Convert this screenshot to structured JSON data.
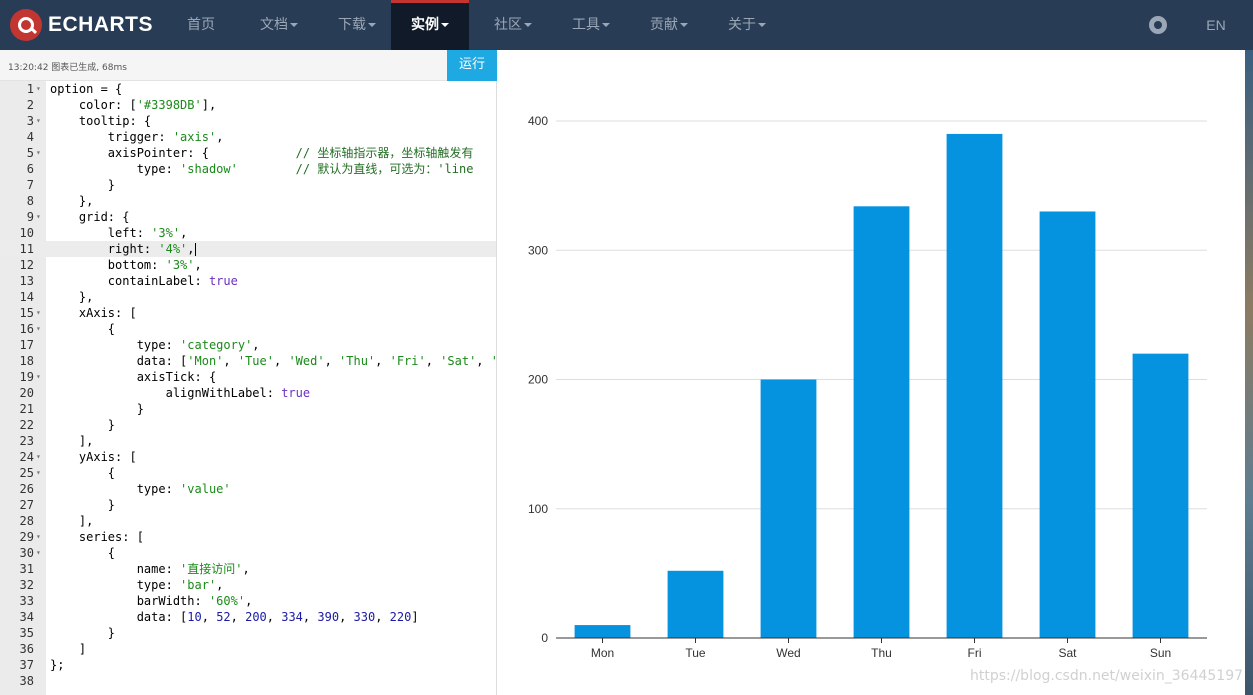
{
  "nav": {
    "logo_text": "ECHARTS",
    "items": [
      {
        "label": "首页",
        "caret": false,
        "active": false
      },
      {
        "label": "文档",
        "caret": true,
        "active": false
      },
      {
        "label": "下载",
        "caret": true,
        "active": false
      },
      {
        "label": "实例",
        "caret": true,
        "active": true
      },
      {
        "label": "社区",
        "caret": true,
        "active": false
      },
      {
        "label": "工具",
        "caret": true,
        "active": false
      },
      {
        "label": "贡献",
        "caret": true,
        "active": false
      },
      {
        "label": "关于",
        "caret": true,
        "active": false
      }
    ],
    "lang": "EN"
  },
  "toolbar": {
    "status": "13:20:42   图表已生成, 68ms",
    "run_label": "运行"
  },
  "editor": {
    "current_line": 11,
    "lines": [
      "option = {",
      "    color: ['#3398DB'],",
      "    tooltip: {",
      "        trigger: 'axis',",
      "        axisPointer: {            // 坐标轴指示器，坐标轴触发有",
      "            type: 'shadow'        // 默认为直线，可选为：'line",
      "        }",
      "    },",
      "    grid: {",
      "        left: '3%',",
      "        right: '4%',",
      "        bottom: '3%',",
      "        containLabel: true",
      "    },",
      "    xAxis: [",
      "        {",
      "            type: 'category',",
      "            data: ['Mon', 'Tue', 'Wed', 'Thu', 'Fri', 'Sat', '",
      "            axisTick: {",
      "                alignWithLabel: true",
      "            }",
      "        }",
      "    ],",
      "    yAxis: [",
      "        {",
      "            type: 'value'",
      "        }",
      "    ],",
      "    series: [",
      "        {",
      "            name: '直接访问',",
      "            type: 'bar',",
      "            barWidth: '60%',",
      "            data: [10, 52, 200, 334, 390, 330, 220]",
      "        }",
      "    ]",
      "};",
      ""
    ],
    "foldable_lines": [
      1,
      3,
      5,
      9,
      15,
      16,
      19,
      24,
      25,
      29,
      30
    ]
  },
  "chart_data": {
    "type": "bar",
    "categories": [
      "Mon",
      "Tue",
      "Wed",
      "Thu",
      "Fri",
      "Sat",
      "Sun"
    ],
    "series": [
      {
        "values": [
          10,
          52,
          200,
          334,
          390,
          330,
          220
        ]
      }
    ],
    "ylim": [
      0,
      400
    ],
    "yticks": [
      0,
      100,
      200,
      300,
      400
    ],
    "color": "#0593e0",
    "grid": true
  },
  "watermark": "https://blog.csdn.net/weixin_36445197",
  "colors": {
    "nav_bg": "#293c55",
    "nav_active_bg": "#101a29",
    "accent_red": "#c23531",
    "run_button": "#1fa9e3"
  }
}
